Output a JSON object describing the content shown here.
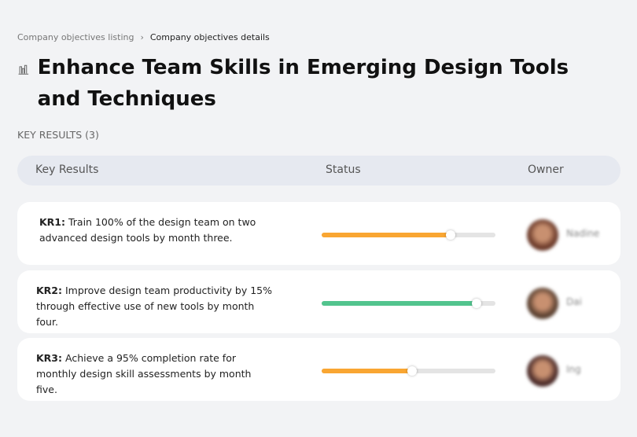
{
  "breadcrumb": {
    "parent": "Company objectives listing",
    "separator": "›",
    "current": "Company objectives details"
  },
  "title": "Enhance Team Skills in Emerging Design Tools and Techniques",
  "title_icon": "building-chart-icon",
  "key_results_label": "KEY RESULTS (3)",
  "table": {
    "headers": [
      "Key Results",
      "Status",
      "Owner"
    ]
  },
  "rows": [
    {
      "id": "KR1:",
      "text": " Train 100% of the design team on two advanced design tools by month three.",
      "progress": 74,
      "color": "#f9a632",
      "owner": "Nadine",
      "avatar": "#6b3a2a"
    },
    {
      "id": "KR2:",
      "text": " Improve design team productivity by 15% through effective use of new tools by month four.",
      "progress": 89,
      "color": "#52c48e",
      "owner": "Dai",
      "avatar": "#5a4030"
    },
    {
      "id": "KR3:",
      "text": " Achieve a 95% completion rate for monthly design skill assessments by month five.",
      "progress": 52,
      "color": "#f9a632",
      "owner": "Ing",
      "avatar": "#4a2a28"
    }
  ]
}
